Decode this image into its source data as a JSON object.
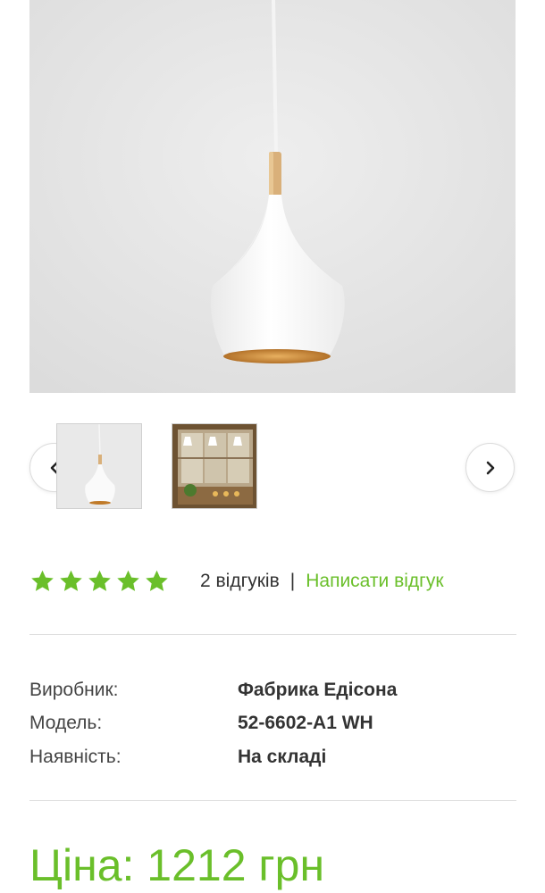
{
  "product": {
    "main_image_alt": "white pendant lamp",
    "thumbnails": [
      {
        "name": "thumbnail-lamp"
      },
      {
        "name": "thumbnail-interior"
      }
    ],
    "nav": {
      "prev_icon": "chevron-left-icon",
      "next_icon": "chevron-right-icon"
    }
  },
  "rating": {
    "stars": 5,
    "star_color": "#6abf2a",
    "reviews_count": "2 відгуків",
    "separator": "|",
    "write_review": "Написати відгук"
  },
  "specs": [
    {
      "label": "Виробник:",
      "value": "Фабрика Едісона"
    },
    {
      "label": "Модель:",
      "value": "52-6602-A1 WH"
    },
    {
      "label": "Наявність:",
      "value": "На складі"
    }
  ],
  "price": {
    "text": "Ціна: 1212 грн",
    "color": "#6abf2a"
  }
}
